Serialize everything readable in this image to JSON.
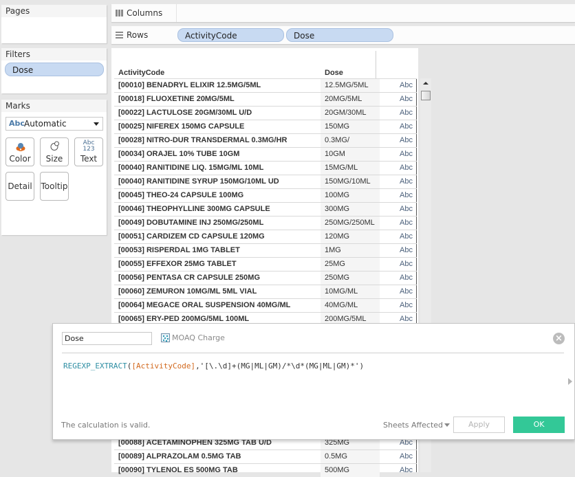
{
  "left_panel": {
    "pages": {
      "title": "Pages"
    },
    "filters": {
      "title": "Filters",
      "items": [
        "Dose"
      ]
    },
    "marks": {
      "title": "Marks",
      "mark_type": {
        "icon_text": "Abc",
        "selected": "Automatic"
      },
      "buttons": [
        {
          "label": "Color",
          "icon": "color-icon"
        },
        {
          "label": "Size",
          "icon": "size-icon"
        },
        {
          "label": "Text",
          "icon": "text-icon",
          "icon_text_top": "Abc",
          "icon_text_bottom": "123"
        },
        {
          "label": "Detail"
        },
        {
          "label": "Tooltip"
        }
      ]
    }
  },
  "shelves": {
    "columns": {
      "label": "Columns",
      "pills": []
    },
    "rows": {
      "label": "Rows",
      "pills": [
        "ActivityCode",
        "Dose"
      ]
    }
  },
  "table": {
    "headers": [
      "ActivityCode",
      "Dose"
    ],
    "mark_text": "Abc",
    "rows": [
      {
        "activity_code": "[00010] BENADRYL ELIXIR 12.5MG/5ML",
        "dose": "12.5MG/5ML"
      },
      {
        "activity_code": "[00018] FLUOXETINE 20MG/5ML",
        "dose": "20MG/5ML"
      },
      {
        "activity_code": "[00022] LACTULOSE 20GM/30ML U/D",
        "dose": "20GM/30ML"
      },
      {
        "activity_code": "[00025] NIFEREX 150MG CAPSULE",
        "dose": "150MG"
      },
      {
        "activity_code": "[00028] NITRO-DUR TRANSDERMAL 0.3MG/HR",
        "dose": "0.3MG/"
      },
      {
        "activity_code": "[00034] ORAJEL 10% TUBE 10GM",
        "dose": "10GM"
      },
      {
        "activity_code": "[00040] RANITIDINE LIQ. 15MG/ML 10ML",
        "dose": "15MG/ML"
      },
      {
        "activity_code": "[00040] RANITIDINE SYRUP 150MG/10ML UD",
        "dose": "150MG/10ML"
      },
      {
        "activity_code": "[00045] THEO-24 CAPSULE 100MG",
        "dose": "100MG"
      },
      {
        "activity_code": "[00046] THEOPHYLLINE 300MG CAPSULE",
        "dose": "300MG"
      },
      {
        "activity_code": "[00049] DOBUTAMINE INJ 250MG/250ML",
        "dose": "250MG/250ML"
      },
      {
        "activity_code": "[00051] CARDIZEM CD CAPSULE 120MG",
        "dose": "120MG"
      },
      {
        "activity_code": "[00053] RISPERDAL 1MG TABLET",
        "dose": "1MG"
      },
      {
        "activity_code": "[00055] EFFEXOR 25MG TABLET",
        "dose": "25MG"
      },
      {
        "activity_code": "[00056] PENTASA CR CAPSULE 250MG",
        "dose": "250MG"
      },
      {
        "activity_code": "[00060] ZEMURON 10MG/ML 5ML VIAL",
        "dose": "10MG/ML"
      },
      {
        "activity_code": "[00064] MEGACE ORAL SUSPENSION 40MG/ML",
        "dose": "40MG/ML"
      },
      {
        "activity_code": "[00065] ERY-PED 200MG/5ML 100ML",
        "dose": "200MG/5ML"
      }
    ],
    "rows_below": [
      {
        "activity_code": "[00088] ACETAMINOPHEN 325MG TAB U/D",
        "dose": "325MG"
      },
      {
        "activity_code": "[00089] ALPRAZOLAM 0.5MG TAB",
        "dose": "0.5MG"
      },
      {
        "activity_code": "[00090] TYLENOL ES 500MG TAB",
        "dose": "500MG"
      }
    ]
  },
  "calc_dialog": {
    "name_value": "Dose",
    "data_source": "MOAQ Charge",
    "formula": {
      "function": "REGEXP_EXTRACT",
      "open": "(",
      "field": "[ActivityCode]",
      "rest": ",'[\\.\\d]+(MG|ML|GM)/*\\d*(MG|ML|GM)*')"
    },
    "status": "The calculation is valid.",
    "sheets_affected": "Sheets Affected",
    "apply_label": "Apply",
    "ok_label": "OK",
    "ok_color": "#33c897"
  }
}
